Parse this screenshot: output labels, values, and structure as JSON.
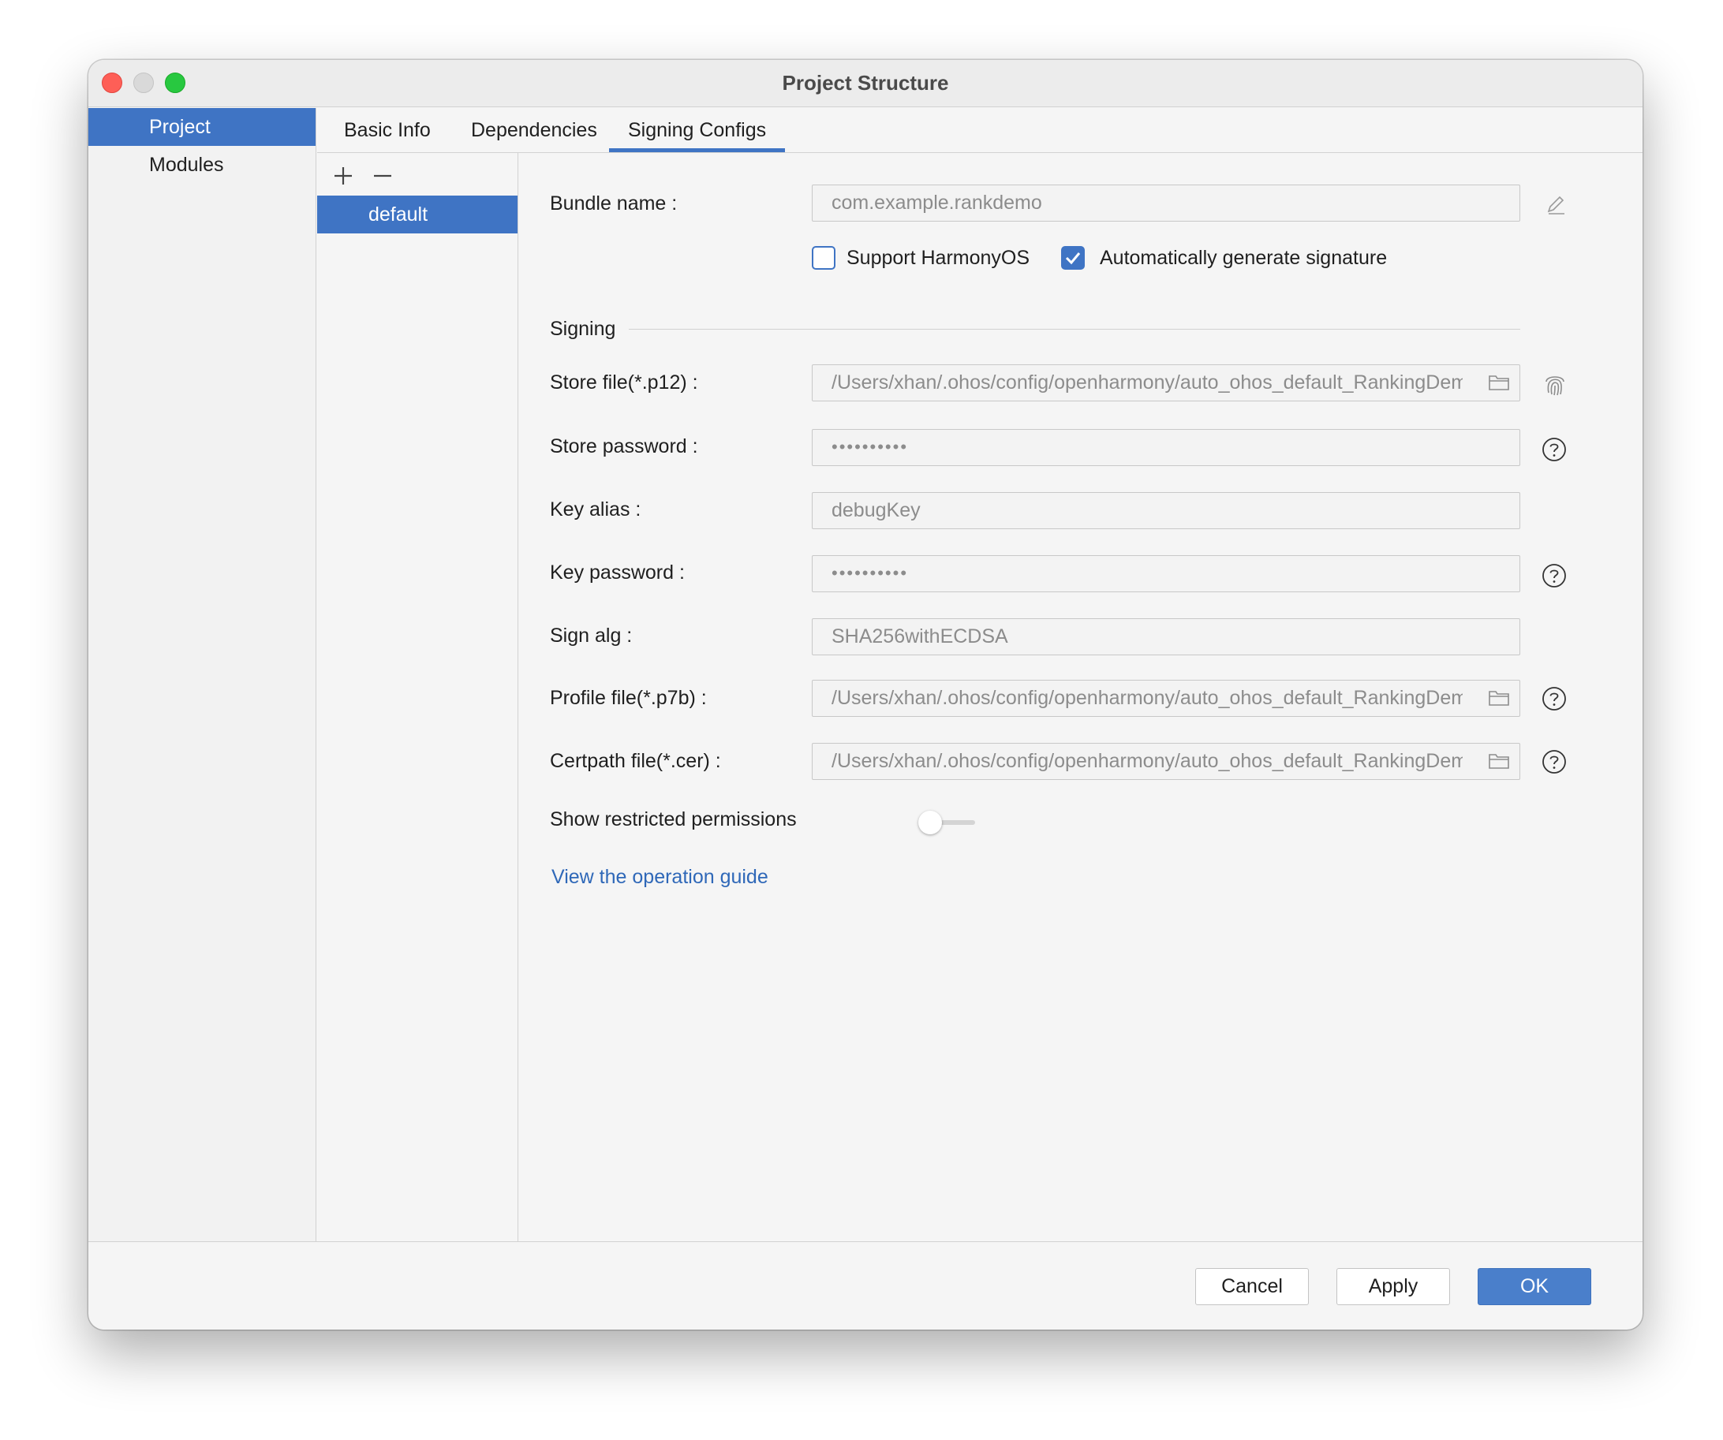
{
  "window": {
    "title": "Project Structure"
  },
  "sidebar": {
    "items": [
      {
        "label": "Project",
        "selected": true
      },
      {
        "label": "Modules",
        "selected": false
      }
    ]
  },
  "tabs": [
    {
      "label": "Basic Info",
      "active": false
    },
    {
      "label": "Dependencies",
      "active": false
    },
    {
      "label": "Signing Configs",
      "active": true
    }
  ],
  "config_list": {
    "add_icon": "plus-icon",
    "remove_icon": "minus-icon",
    "items": [
      {
        "label": "default",
        "selected": true
      }
    ]
  },
  "form": {
    "bundle_name": {
      "label": "Bundle name :",
      "value": "com.example.rankdemo"
    },
    "support_harmonyos": {
      "label": "Support HarmonyOS",
      "checked": false
    },
    "auto_signature": {
      "label": "Automatically generate signature",
      "checked": true
    },
    "signing_section": "Signing",
    "store_file": {
      "label": "Store file(*.p12) :",
      "value": "/Users/xhan/.ohos/config/openharmony/auto_ohos_default_RankingDemo"
    },
    "store_password": {
      "label": "Store password :",
      "value": "••••••••••"
    },
    "key_alias": {
      "label": "Key alias :",
      "value": "debugKey"
    },
    "key_password": {
      "label": "Key password :",
      "value": "••••••••••"
    },
    "sign_alg": {
      "label": "Sign alg :",
      "value": "SHA256withECDSA"
    },
    "profile_file": {
      "label": "Profile file(*.p7b) :",
      "value": "/Users/xhan/.ohos/config/openharmony/auto_ohos_default_RankingDemo"
    },
    "certpath_file": {
      "label": "Certpath file(*.cer) :",
      "value": "/Users/xhan/.ohos/config/openharmony/auto_ohos_default_RankingDemo"
    },
    "restricted_permissions": {
      "label": "Show restricted permissions",
      "enabled": false
    },
    "guide_link": "View the operation guide"
  },
  "buttons": {
    "cancel": "Cancel",
    "apply": "Apply",
    "ok": "OK"
  },
  "colors": {
    "accent": "#3f74c4",
    "link": "#2f68b8",
    "window_bg": "#f5f5f5"
  }
}
